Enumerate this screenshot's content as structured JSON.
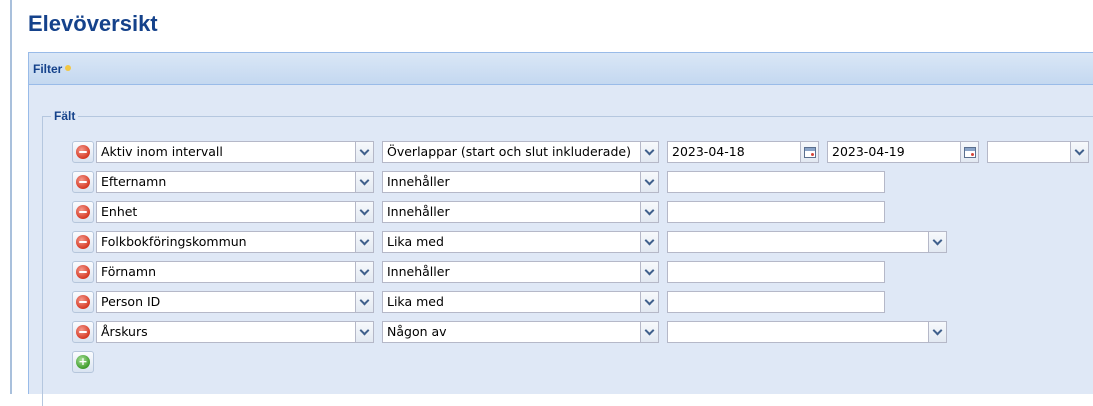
{
  "page": {
    "title": "Elevöversikt"
  },
  "panel": {
    "title": "Filter"
  },
  "fieldset": {
    "legend": "Fält"
  },
  "rows": [
    {
      "field": "Aktiv inom intervall",
      "operator": "Överlappar (start och slut inkluderade)",
      "value_from": "2023-04-18",
      "value_to": "2023-04-19",
      "extra": ""
    },
    {
      "field": "Efternamn",
      "operator": "Innehåller",
      "value": ""
    },
    {
      "field": "Enhet",
      "operator": "Innehåller",
      "value": ""
    },
    {
      "field": "Folkbokföringskommun",
      "operator": "Lika med",
      "value": ""
    },
    {
      "field": "Förnamn",
      "operator": "Innehåller",
      "value": ""
    },
    {
      "field": "Person ID",
      "operator": "Lika med",
      "value": ""
    },
    {
      "field": "Årskurs",
      "operator": "Någon av",
      "value": ""
    }
  ],
  "colors": {
    "title": "#15428b",
    "panel_bg": "#dfe8f6",
    "panel_border": "#99bbe8",
    "remove_button": "#d63a25",
    "add_button": "#3f9c2c"
  },
  "icons": {
    "remove": "remove-circle-icon",
    "add": "add-circle-icon",
    "dropdown": "chevron-down-icon",
    "date": "calendar-icon"
  }
}
